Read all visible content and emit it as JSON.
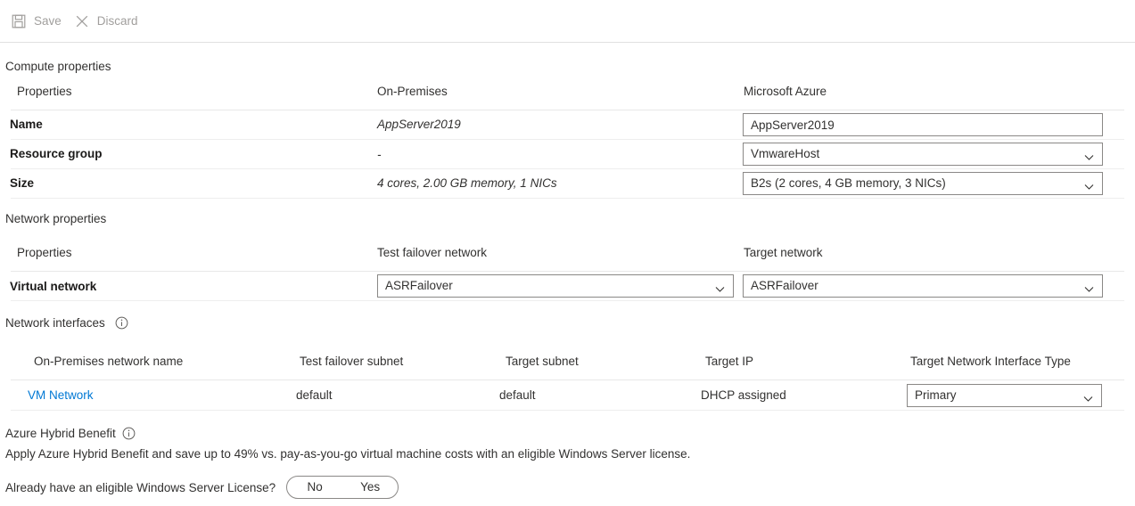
{
  "toolbar": {
    "save_label": "Save",
    "discard_label": "Discard",
    "save_icon": "save-floppy-icon",
    "discard_icon": "close-x-icon"
  },
  "compute": {
    "section_title": "Compute properties",
    "headers": {
      "properties": "Properties",
      "on_premises": "On-Premises",
      "azure": "Microsoft Azure"
    },
    "rows": [
      {
        "label": "Name",
        "on_prem": "AppServer2019",
        "azure_value": "AppServer2019",
        "control": "text"
      },
      {
        "label": "Resource group",
        "on_prem": "-",
        "azure_value": "VmwareHost",
        "control": "select"
      },
      {
        "label": "Size",
        "on_prem": "4 cores, 2.00 GB memory, 1 NICs",
        "azure_value": "B2s (2 cores, 4 GB memory, 3 NICs)",
        "control": "select"
      }
    ]
  },
  "network": {
    "section_title": "Network properties",
    "headers": {
      "properties": "Properties",
      "test_failover_network": "Test failover network",
      "target_network": "Target network"
    },
    "rows": [
      {
        "label": "Virtual network",
        "test_failover": "ASRFailover",
        "target": "ASRFailover"
      }
    ]
  },
  "nics": {
    "section_title": "Network interfaces",
    "info_icon": "info-circle-icon",
    "headers": {
      "name": "On-Premises network name",
      "test_subnet": "Test failover subnet",
      "target_subnet": "Target subnet",
      "target_ip": "Target IP",
      "nic_type": "Target Network Interface Type"
    },
    "rows": [
      {
        "name": "VM Network",
        "test_subnet": "default",
        "target_subnet": "default",
        "target_ip": "DHCP assigned",
        "nic_type": "Primary"
      }
    ]
  },
  "hybrid_benefit": {
    "section_title": "Azure Hybrid Benefit",
    "info_icon": "info-circle-icon",
    "description": "Apply Azure Hybrid Benefit and save up to 49% vs. pay-as-you-go virtual machine costs with an eligible Windows Server license.",
    "question": "Already have an eligible Windows Server License?",
    "options": [
      "No",
      "Yes"
    ]
  },
  "colors": {
    "link": "#0078d4",
    "text": "#323130",
    "muted": "#a19f9d",
    "border": "#8a8886",
    "divider": "#eeeeee"
  }
}
